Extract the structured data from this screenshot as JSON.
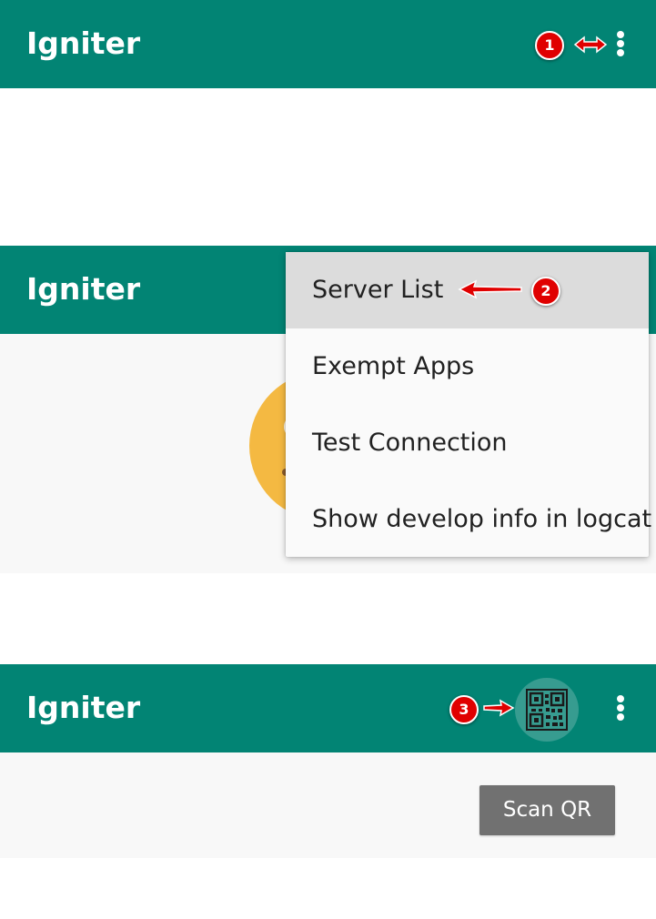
{
  "app": {
    "title": "Igniter"
  },
  "steps": {
    "step1": "1",
    "step2": "2",
    "step3": "3"
  },
  "menu": {
    "items": [
      {
        "label": "Server List",
        "active": true
      },
      {
        "label": "Exempt Apps",
        "active": false
      },
      {
        "label": "Test Connection",
        "active": false
      },
      {
        "label": "Show develop info in logcat",
        "active": false
      }
    ]
  },
  "icons": {
    "overflow": "more-vert-icon",
    "qr": "qr-code-icon",
    "status": "status-face-icon",
    "annotation_arrow": "red-arrow-icon"
  },
  "scan": {
    "button_label": "Scan QR"
  },
  "colors": {
    "toolbar": "#028474",
    "qr_button": "#379c90",
    "status_face": "#f4b942",
    "scan_button": "#717171",
    "badge": "#e00000",
    "menu_active": "#dcdcdc"
  }
}
